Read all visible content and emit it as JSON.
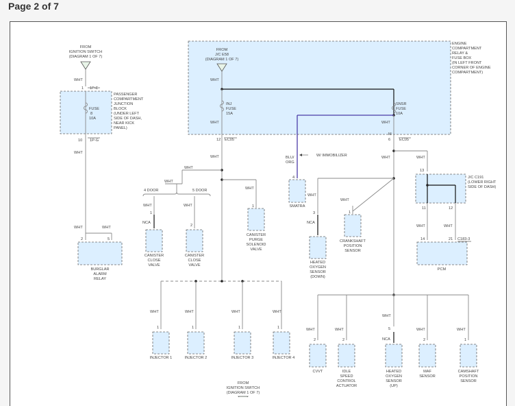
{
  "header": {
    "title": "Page 2 of 7"
  },
  "wire_colors": {
    "white": "WHT",
    "blue_orange": [
      "BLU/",
      "ORG"
    ]
  },
  "fuse_box_left": {
    "from": [
      "FROM",
      "IGNITION SWITCH",
      "(DIAGRAM 1 OF 7)"
    ],
    "pin_top": "1",
    "conn_top": "1P-E",
    "fuse": [
      "FUSE",
      "8",
      "10A"
    ],
    "desc": [
      "PASSENGER",
      "COMPARTMENT",
      "JUNCTION",
      "BLOCK",
      "(UNDER LEFT",
      "SIDE OF DASH,",
      "NEAR KICK",
      "PANEL)"
    ],
    "pin_bottom": "10",
    "conn_bottom": "1P-G"
  },
  "fuse_box_right": {
    "from": [
      "FROM",
      "J/C E58",
      "(DIAGRAM 1 OF 7)"
    ],
    "fuse1": [
      "INJ",
      "FUSE",
      "15A"
    ],
    "fuse2": [
      "SNSR",
      "FUSE",
      "10A"
    ],
    "desc": [
      "ENGINE",
      "COMPARTMENT",
      "RELAY &",
      "FUSE BOX",
      "(IN LEFT FRONT",
      "CORNER OF ENGINE",
      "COMPARTMENT)"
    ],
    "pin_left": "12",
    "conn_left": "EC05",
    "pin_right": "6",
    "pin_right2": "M",
    "conn_right": "EC05"
  },
  "labels": {
    "immobilizer": "W/ IMMOBILIZER",
    "door4": "4 DOOR",
    "door5": "5 DOOR",
    "nca": "NCA",
    "jc_c191": [
      "J/C C191",
      "(LOWER RIGHT",
      "SIDE OF DASH)"
    ],
    "pcm_conn": "C183-3",
    "bottom_from": [
      "FROM",
      "IGNITION SWITCH",
      "(DIAGRAM 1 OF 7)"
    ]
  },
  "pins": {
    "burglar_a": "2",
    "burglar_b": "5",
    "can_close_4": "1",
    "can_close_5": "2",
    "purge": "1",
    "smatra": "4",
    "ho2s_down": "3",
    "ckp": "1",
    "jc_top": "13",
    "jc_b1": "11",
    "jc_b2": "12",
    "pcm1": "14",
    "pcm2": "21",
    "inj1": "1",
    "inj2": "1",
    "inj3": "1",
    "inj4": "1",
    "cvvt": "2",
    "isc": "2",
    "ho2s_up": "5",
    "maf": "2",
    "cmp": "1"
  },
  "components": {
    "burglar": [
      "BURGLAR",
      "ALARM",
      "RELAY"
    ],
    "can_close_4": [
      "CANISTER",
      "CLOSE",
      "VALVE"
    ],
    "can_close_5": [
      "CANISTER",
      "CLOSE",
      "VALVE"
    ],
    "purge": [
      "CANISTER",
      "PURGE",
      "SOLENOID",
      "VALVE"
    ],
    "smatra": [
      "SMATRA"
    ],
    "ho2s_down": [
      "HEATED",
      "OXYGEN",
      "SENSOR",
      "(DOWN)"
    ],
    "ckp": [
      "CRANKSHAFT",
      "POSITION",
      "SENSOR"
    ],
    "pcm": [
      "PCM"
    ],
    "inj1": [
      "INJECTOR 1"
    ],
    "inj2": [
      "INJECTOR 2"
    ],
    "inj3": [
      "INJECTOR 3"
    ],
    "inj4": [
      "INJECTOR 4"
    ],
    "cvvt": [
      "CVVT"
    ],
    "isc": [
      "IDLE",
      "SPEED",
      "CONTROL",
      "ACTUATOR"
    ],
    "ho2s_up": [
      "HEATED",
      "OXYGEN",
      "SENSOR",
      "(UP)"
    ],
    "maf": [
      "MAF",
      "SENSOR"
    ],
    "cmp": [
      "CAMSHAFT",
      "POSITION",
      "SENSOR"
    ]
  }
}
